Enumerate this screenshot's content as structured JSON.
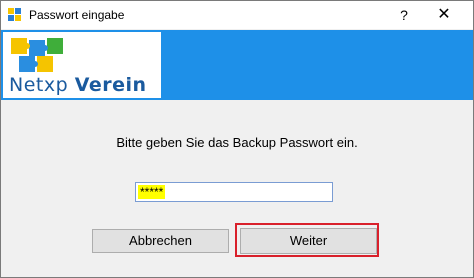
{
  "window": {
    "title": "Passwort eingabe",
    "help_label": "?",
    "close_label": "✕"
  },
  "banner": {
    "logo_text_prefix": "Netxp ",
    "logo_text_bold": "Verein",
    "color": "#1e90e8"
  },
  "dialog": {
    "prompt": "Bitte geben Sie das Backup Passwort ein.",
    "password_value": "*****"
  },
  "buttons": {
    "cancel_label": "Abbrechen",
    "next_label": "Weiter"
  }
}
